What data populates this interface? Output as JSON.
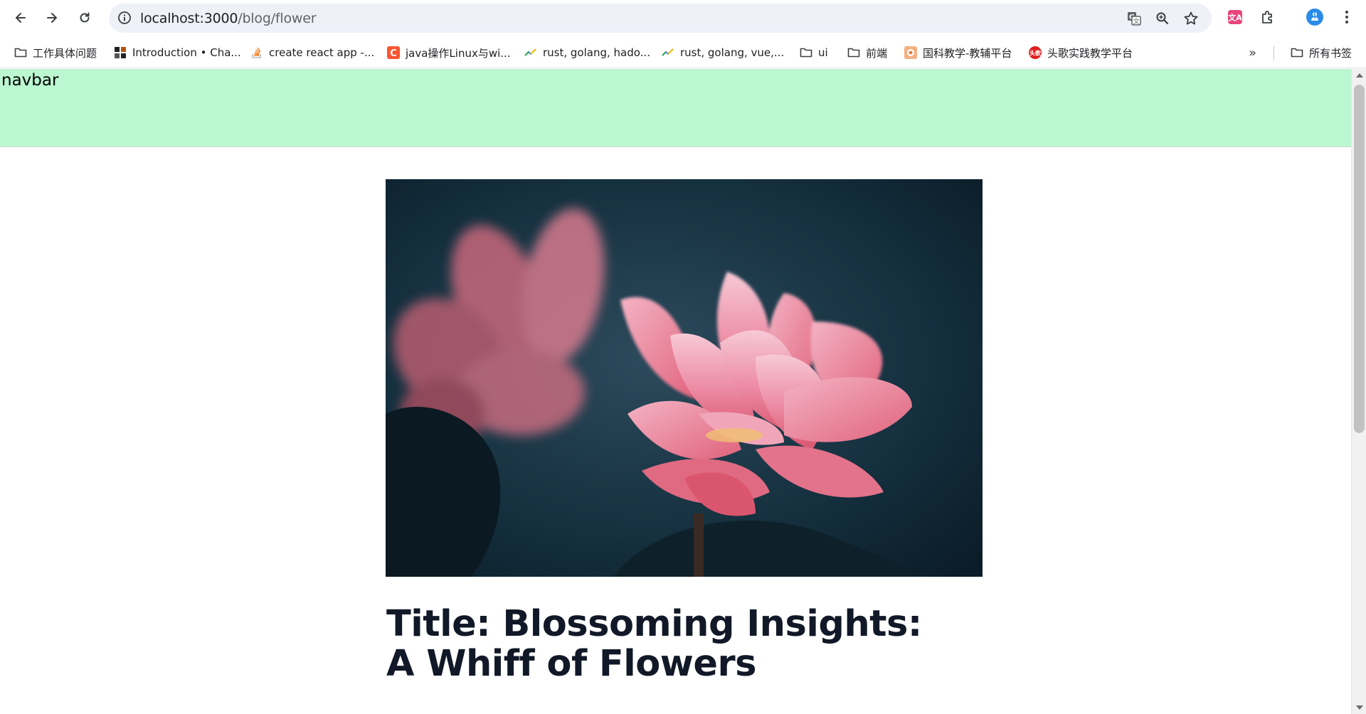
{
  "browser": {
    "url_host": "localhost:3000",
    "url_path": "/blog/flower",
    "icons": {
      "back": "back-arrow-icon",
      "forward": "forward-arrow-icon",
      "reload": "reload-icon",
      "info": "site-info-icon",
      "translate": "translate-icon",
      "zoom": "zoom-icon",
      "bookmark_star": "star-icon",
      "extension1": "translate-extension-icon",
      "extensions": "puzzle-icon",
      "profile": "profile-avatar-icon",
      "menu": "kebab-menu-icon"
    }
  },
  "bookmarks": [
    {
      "label": "工作具体问题",
      "icon": "folder-icon"
    },
    {
      "label": "Introduction • Cha...",
      "icon": "site-favicon"
    },
    {
      "label": "create react app -...",
      "icon": "stackoverflow-icon"
    },
    {
      "label": "java操作Linux与wi...",
      "icon": "csdn-icon"
    },
    {
      "label": "rust, golang, hado...",
      "icon": "trend-icon"
    },
    {
      "label": "rust, golang, vue,...",
      "icon": "trend-icon"
    },
    {
      "label": "ui",
      "icon": "folder-icon"
    },
    {
      "label": "前端",
      "icon": "folder-icon"
    },
    {
      "label": "国科教学-教辅平台",
      "icon": "site-favicon"
    },
    {
      "label": "头歌实践教学平台",
      "icon": "site-favicon"
    }
  ],
  "bookmarks_overflow": "»",
  "all_bookmarks": "所有书签",
  "page": {
    "navbar_text": "navbar",
    "title": "Title: Blossoming Insights: A Whiff of Flowers"
  },
  "colors": {
    "navbar_bg": "#bbf7d0",
    "title_color": "#111827",
    "omnibox_bg": "#eef1f8"
  }
}
